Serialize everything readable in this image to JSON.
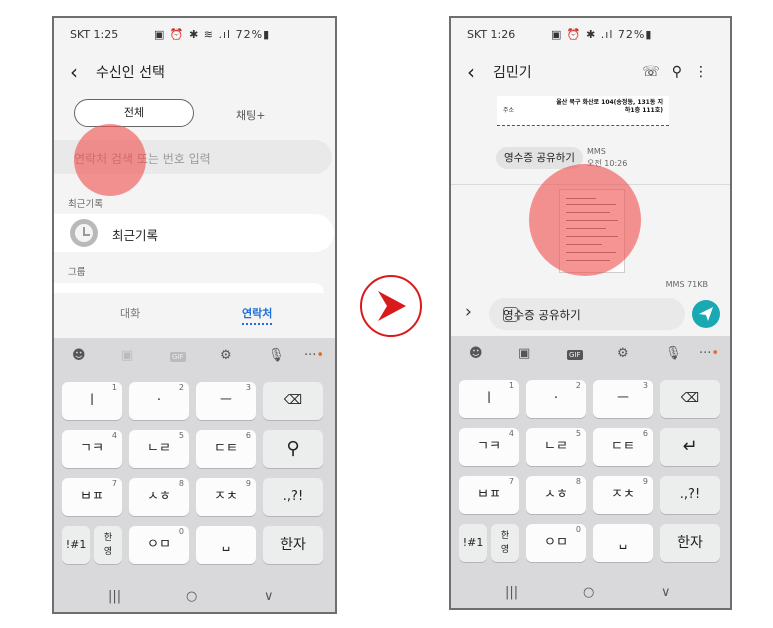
{
  "left": {
    "status": {
      "time": "SKT 1:25",
      "icons": "▣  ⏰ ✱ ≋ .ıl",
      "battery": "72%▮"
    },
    "header": {
      "title": "수신인 선택"
    },
    "tabs": {
      "active": "전체",
      "other": "채팅+"
    },
    "search": {
      "placeholder": "연락처 검색 또는 번호 입력"
    },
    "recent_section": "최근기록",
    "recent_item": "최근기록",
    "group_section": "그룹",
    "bottom_tabs": {
      "conversations": "대화",
      "contacts": "연락처"
    }
  },
  "right": {
    "status": {
      "time": "SKT 1:26",
      "icons": "▣  ⏰ ✱ .ıl",
      "battery": "72%▮"
    },
    "header": {
      "title": "김민기"
    },
    "receipt": {
      "address_label": "주소",
      "address": "울산 북구 화산로 104(송정동, 131동 지하1층 111호)"
    },
    "message": {
      "chip": "영수증 공유하기",
      "type": "MMS",
      "time": "오전 10:26"
    },
    "mms_size": "MMS 71KB",
    "composer_text": "영수증 공유하기"
  },
  "keyboard": {
    "row1": [
      "ㅣ",
      "·",
      "ㅡ"
    ],
    "row1_hints": [
      "1",
      "2",
      "3"
    ],
    "row2": [
      "ㄱㅋ",
      "ㄴㄹ",
      "ㄷㅌ"
    ],
    "row2_hints": [
      "4",
      "5",
      "6"
    ],
    "row3": [
      "ㅂㅍ",
      "ㅅㅎ",
      "ㅈㅊ",
      ".,?!"
    ],
    "row3_hints": [
      "7",
      "8",
      "9"
    ],
    "row4": {
      "sym": "!#1",
      "lang_top": "한",
      "lang_bottom": "영",
      "vowel": "ㅇㅁ",
      "vowel_hint": "0",
      "space": "␣",
      "hanja": "한자"
    },
    "toolbar": {
      "emoji": "☻",
      "sticker": "▣",
      "gif": "GIF",
      "settings": "⚙",
      "mic": "🎙",
      "more": "···",
      "dot": "•"
    },
    "backspace": "⌫",
    "search": "⚲",
    "enter": "↵",
    "nav": {
      "recent": "|||",
      "home": "○",
      "back": "∨"
    }
  },
  "colors": {
    "accent_blue": "#1e6fd9",
    "send_teal": "#1aa9b3",
    "touch": "#f05050",
    "arrow_red": "#d91a1a"
  }
}
